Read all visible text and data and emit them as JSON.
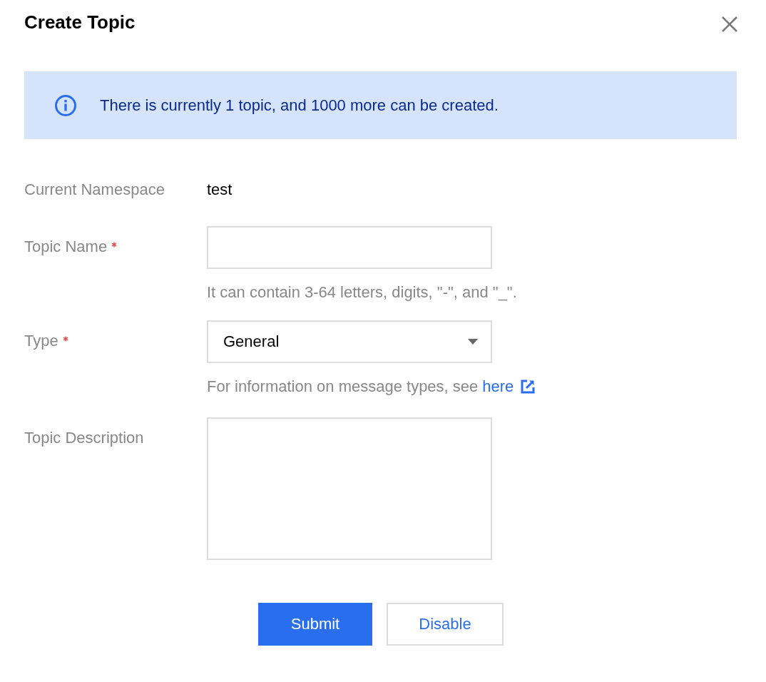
{
  "dialog": {
    "title": "Create Topic"
  },
  "notice": {
    "text": "There is currently 1 topic, and 1000 more can be created."
  },
  "fields": [
    {
      "kind": "text",
      "label": "Current Namespace",
      "required": false,
      "value": "test"
    },
    {
      "kind": "input",
      "label": "Topic Name",
      "required": true,
      "hint": "It can contain 3-64 letters, digits, \"-\", and \"_\"."
    },
    {
      "kind": "select",
      "label": "Type",
      "required": true,
      "value": "General",
      "hint": "For information on message types, see ",
      "hint_link": "here"
    },
    {
      "kind": "textarea",
      "label": "Topic Description",
      "required": false
    }
  ],
  "buttons": [
    {
      "label": "Submit",
      "primary": true
    },
    {
      "label": "Disable",
      "primary": false
    }
  ]
}
